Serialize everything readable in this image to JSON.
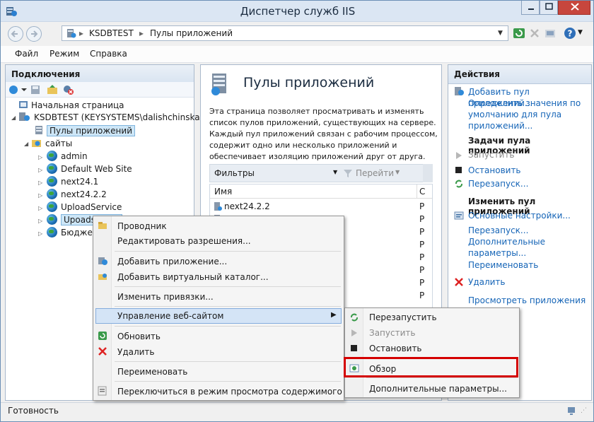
{
  "window": {
    "title": "Диспетчер служб IIS"
  },
  "address": {
    "crumbs": [
      "KSDBTEST",
      "Пулы приложений"
    ]
  },
  "menu": [
    "Файл",
    "Режим",
    "Справка"
  ],
  "connections": {
    "header": "Подключения",
    "tree": [
      {
        "label": "Начальная страница"
      },
      {
        "label": "KSDBTEST (KEYSYSTEMS\\dalishchinskaya)"
      },
      {
        "label": "Пулы приложений"
      },
      {
        "label": "сайты"
      },
      {
        "label": "admin"
      },
      {
        "label": "Default Web Site"
      },
      {
        "label": "next24.1"
      },
      {
        "label": "next24.2.2"
      },
      {
        "label": "UploadService"
      },
      {
        "label": "Upoadse"
      },
      {
        "label": "Бюджет"
      }
    ]
  },
  "center": {
    "title": "Пулы приложений",
    "description": [
      "Эта страница позволяет просматривать и изменять",
      "список пулов приложений, существующих на сервере.",
      "Каждый пул приложений связан с рабочим процессом,",
      "содержит одно или несколько приложений и",
      "обеспечивает изоляцию приложений друг от друга."
    ],
    "filter_label": "Фильтры:",
    "go_label": "Перейти",
    "column_name": "Имя",
    "column_status": "С",
    "rows": [
      {
        "name": "next24.2.2",
        "status": "Р"
      },
      {
        "name": "",
        "status": "Р"
      },
      {
        "name": "",
        "status": "Р"
      },
      {
        "name": "",
        "status": "Р"
      },
      {
        "name": "",
        "status": "Р"
      },
      {
        "name": "",
        "status": "Р"
      },
      {
        "name": "",
        "status": "Р"
      },
      {
        "name": "",
        "status": "Р"
      }
    ]
  },
  "actions": {
    "header": "Действия",
    "add_pool": "Добавить пул приложений...",
    "set_defaults": [
      "Определить значения по",
      "умолчанию для пула",
      "приложений..."
    ],
    "tasks_header": "Задачи пула приложений",
    "start": "Запустить",
    "stop": "Остановить",
    "recycle": "Перезапуск...",
    "edit_header": "Изменить пул приложений",
    "basic_settings": "Основные настройки...",
    "recycle2": "Перезапуск...",
    "advanced": [
      "Дополнительные",
      "параметры..."
    ],
    "rename": "Переименовать",
    "remove": "Удалить",
    "view_apps": "Просмотреть приложения"
  },
  "context_menu": {
    "items": [
      "Проводник",
      "Редактировать разрешения...",
      "Добавить приложение...",
      "Добавить виртуальный каталог...",
      "Изменить привязки...",
      "Управление веб-сайтом",
      "Обновить",
      "Удалить",
      "Переименовать",
      "Переключиться в режим просмотра содержимого"
    ]
  },
  "submenu": {
    "items": [
      "Перезапустить",
      "Запустить",
      "Остановить",
      "Обзор",
      "Дополнительные параметры..."
    ]
  },
  "status": {
    "text": "Готовность"
  },
  "colors": {
    "accent": "#1665b7",
    "highlight_border": "#d40000"
  }
}
